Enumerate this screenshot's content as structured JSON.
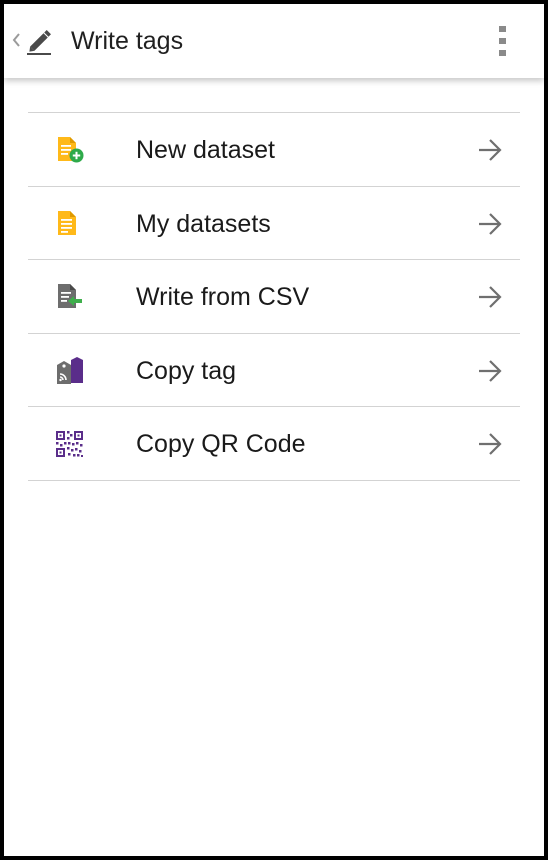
{
  "app_bar": {
    "title": "Write tags",
    "back_icon": "chevron-left-icon",
    "title_icon": "pencil-icon",
    "overflow_icon": "more-vertical-icon"
  },
  "menu": {
    "items": [
      {
        "label": "New dataset",
        "icon": "document-add-icon"
      },
      {
        "label": "My datasets",
        "icon": "document-icon"
      },
      {
        "label": "Write from CSV",
        "icon": "document-import-icon"
      },
      {
        "label": "Copy tag",
        "icon": "tag-copy-icon"
      },
      {
        "label": "Copy QR Code",
        "icon": "qr-code-icon"
      }
    ],
    "arrow_icon": "arrow-right-icon"
  },
  "colors": {
    "document_yellow": "#FFB919",
    "add_green": "#2EAA4A",
    "import_green": "#3FAF4C",
    "document_gray": "#6D6D6D",
    "tag_purple": "#5A2D8A",
    "qr_purple": "#5A2D8A",
    "arrow_gray": "#6F6F6F"
  }
}
